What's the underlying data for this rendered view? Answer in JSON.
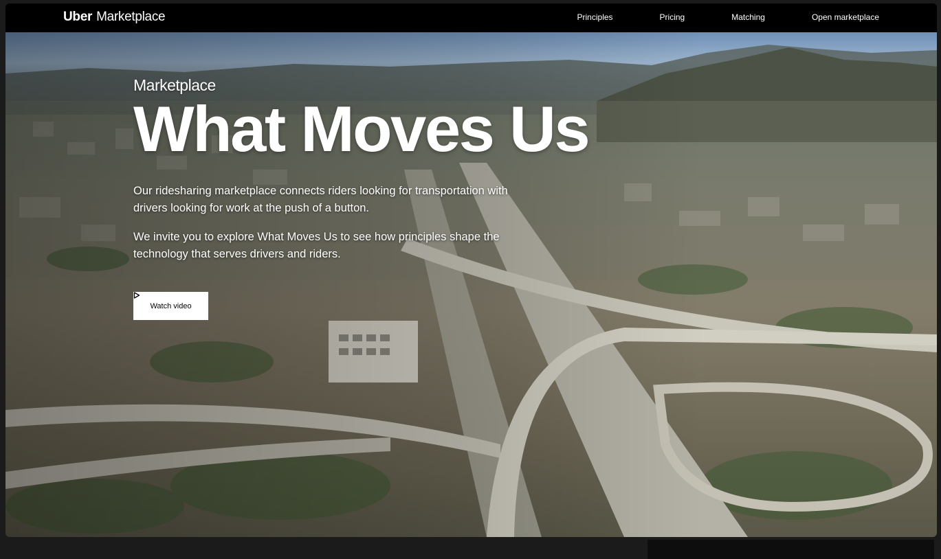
{
  "nav": {
    "brand": "Uber",
    "product": "Marketplace",
    "links": [
      "Principles",
      "Pricing",
      "Matching",
      "Open marketplace"
    ]
  },
  "hero": {
    "eyebrow": "Marketplace",
    "headline": "What Moves Us",
    "paragraphs": [
      "Our ridesharing marketplace connects riders looking for transportation with drivers looking for work at the push of a button.",
      "We invite you to explore What Moves Us to see how principles shape the technology that serves drivers and riders."
    ],
    "cta": "Watch video",
    "background_image": "aerial-freeway-interchange"
  },
  "colors": {
    "nav_bg": "#000000",
    "text": "#ffffff",
    "button_bg": "#ffffff",
    "button_text": "#000000"
  }
}
